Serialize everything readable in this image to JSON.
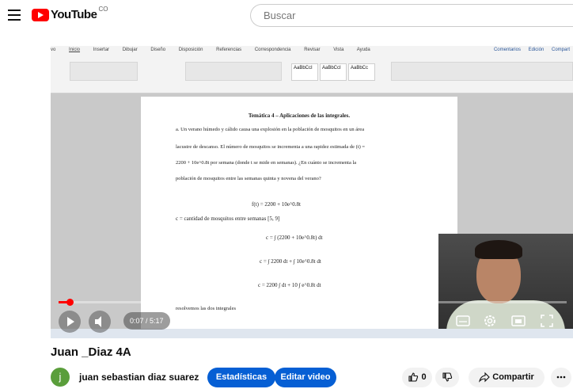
{
  "header": {
    "logo_text": "YouTube",
    "logo_country": "CO",
    "search_placeholder": "Buscar"
  },
  "video": {
    "ribbon_tabs": [
      "vo",
      "Inicio",
      "Insertar",
      "Dibujar",
      "Diseño",
      "Disposición",
      "Referencias",
      "Correspondencia",
      "Revisar",
      "Vista",
      "Ayuda"
    ],
    "ribbon_right": [
      "Comentarios",
      "Edición",
      "Compart"
    ],
    "styles": [
      "AaBbCcI",
      "AaBbCcI",
      "AaBbCc"
    ],
    "doc": {
      "title": "Temática 4 – Aplicaciones de las integrales.",
      "para1": "a. Un verano húmedo y cálido causa una explosión en la población de mosquitos en un área",
      "para2": "lacustre de descanso. El número de mosquitos se incrementa a una rapidez estimada de (t) =",
      "para3": "2200 + 10e^0.8t por semana (donde t se mide en semanas). ¿En cuánto se incrementa la",
      "para4": "población de mosquitos entre las semanas quinta y novena del verano?",
      "eq1": "f(t) = 2200 + 10e^0.8t",
      "eq2": "c = cantidad de mosquitos entre semanas [5, 9]",
      "eq3": "c = ∫ (2200 + 10e^0.8t) dt",
      "eq4": "c = ∫ 2200 dt + ∫ 10e^0.8t dt",
      "eq5": "c = 2200 ∫ dt + 10 ∫ e^0.8t dt",
      "para5": "resolvemos las dos integrales"
    },
    "time_display": "0:07 / 5:17",
    "progress_fraction": 0.022
  },
  "title": "Juan _Diaz 4A",
  "channel": {
    "avatar_letter": "j",
    "name": "juan sebastian diaz suarez"
  },
  "actions": {
    "stats_label": "Estadísticas",
    "edit_label": "Editar video",
    "like_count": "0",
    "share_label": "Compartir"
  },
  "colors": {
    "brand_red": "#ff0000",
    "button_blue": "#065fd4"
  }
}
